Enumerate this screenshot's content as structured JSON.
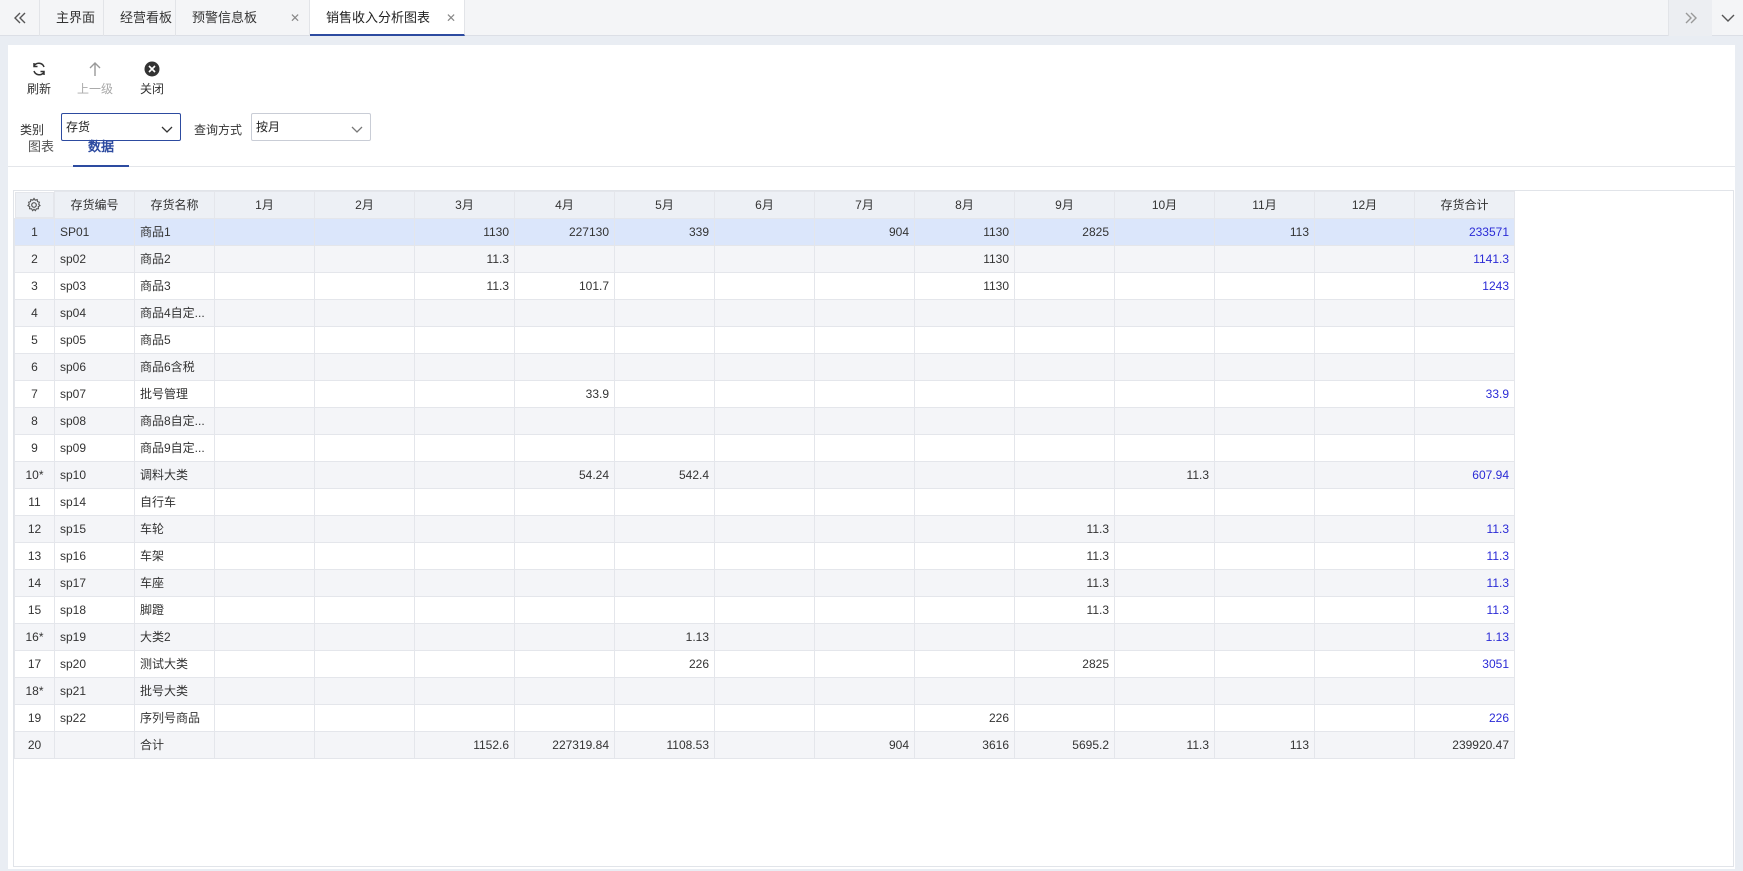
{
  "tabs": [
    {
      "label": "主界面",
      "closable": false,
      "active": false
    },
    {
      "label": "经营看板",
      "closable": false,
      "active": false
    },
    {
      "label": "预警信息板",
      "closable": true,
      "active": false
    },
    {
      "label": "销售收入分析图表",
      "closable": true,
      "active": true
    }
  ],
  "toolbar": {
    "refresh": "刷新",
    "up": "上一级",
    "close": "关闭"
  },
  "filters": {
    "category_label": "类别",
    "category_value": "存货",
    "mode_label": "查询方式",
    "mode_value": "按月"
  },
  "view_tabs": [
    {
      "label": "图表",
      "active": false
    },
    {
      "label": "数据",
      "active": true
    }
  ],
  "grid": {
    "columns": [
      "存货编号",
      "存货名称",
      "1月",
      "2月",
      "3月",
      "4月",
      "5月",
      "6月",
      "7月",
      "8月",
      "9月",
      "10月",
      "11月",
      "12月",
      "存货合计"
    ],
    "rows": [
      {
        "idx": "1",
        "code": "SP01",
        "name": "商品1",
        "m": [
          "",
          "",
          "1130",
          "227130",
          "339",
          "",
          "904",
          "1130",
          "2825",
          "",
          "113",
          ""
        ],
        "total": "233571"
      },
      {
        "idx": "2",
        "code": "sp02",
        "name": "商品2",
        "m": [
          "",
          "",
          "11.3",
          "",
          "",
          "",
          "",
          "1130",
          "",
          "",
          "",
          ""
        ],
        "total": "1141.3"
      },
      {
        "idx": "3",
        "code": "sp03",
        "name": "商品3",
        "m": [
          "",
          "",
          "11.3",
          "101.7",
          "",
          "",
          "",
          "1130",
          "",
          "",
          "",
          ""
        ],
        "total": "1243"
      },
      {
        "idx": "4",
        "code": "sp04",
        "name": "商品4自定...",
        "m": [
          "",
          "",
          "",
          "",
          "",
          "",
          "",
          "",
          "",
          "",
          "",
          ""
        ],
        "total": ""
      },
      {
        "idx": "5",
        "code": "sp05",
        "name": "商品5",
        "m": [
          "",
          "",
          "",
          "",
          "",
          "",
          "",
          "",
          "",
          "",
          "",
          ""
        ],
        "total": ""
      },
      {
        "idx": "6",
        "code": "sp06",
        "name": "商品6含税",
        "m": [
          "",
          "",
          "",
          "",
          "",
          "",
          "",
          "",
          "",
          "",
          "",
          ""
        ],
        "total": ""
      },
      {
        "idx": "7",
        "code": "sp07",
        "name": "批号管理",
        "m": [
          "",
          "",
          "",
          "33.9",
          "",
          "",
          "",
          "",
          "",
          "",
          "",
          ""
        ],
        "total": "33.9"
      },
      {
        "idx": "8",
        "code": "sp08",
        "name": "商品8自定...",
        "m": [
          "",
          "",
          "",
          "",
          "",
          "",
          "",
          "",
          "",
          "",
          "",
          ""
        ],
        "total": ""
      },
      {
        "idx": "9",
        "code": "sp09",
        "name": "商品9自定...",
        "m": [
          "",
          "",
          "",
          "",
          "",
          "",
          "",
          "",
          "",
          "",
          "",
          ""
        ],
        "total": ""
      },
      {
        "idx": "10*",
        "code": "sp10",
        "name": "调料大类",
        "m": [
          "",
          "",
          "",
          "54.24",
          "542.4",
          "",
          "",
          "",
          "",
          "11.3",
          "",
          ""
        ],
        "total": "607.94"
      },
      {
        "idx": "11",
        "code": "sp14",
        "name": "自行车",
        "m": [
          "",
          "",
          "",
          "",
          "",
          "",
          "",
          "",
          "",
          "",
          "",
          ""
        ],
        "total": ""
      },
      {
        "idx": "12",
        "code": "sp15",
        "name": "车轮",
        "m": [
          "",
          "",
          "",
          "",
          "",
          "",
          "",
          "",
          "11.3",
          "",
          "",
          ""
        ],
        "total": "11.3"
      },
      {
        "idx": "13",
        "code": "sp16",
        "name": "车架",
        "m": [
          "",
          "",
          "",
          "",
          "",
          "",
          "",
          "",
          "11.3",
          "",
          "",
          ""
        ],
        "total": "11.3"
      },
      {
        "idx": "14",
        "code": "sp17",
        "name": "车座",
        "m": [
          "",
          "",
          "",
          "",
          "",
          "",
          "",
          "",
          "11.3",
          "",
          "",
          ""
        ],
        "total": "11.3"
      },
      {
        "idx": "15",
        "code": "sp18",
        "name": "脚蹬",
        "m": [
          "",
          "",
          "",
          "",
          "",
          "",
          "",
          "",
          "11.3",
          "",
          "",
          ""
        ],
        "total": "11.3"
      },
      {
        "idx": "16*",
        "code": "sp19",
        "name": "大类2",
        "m": [
          "",
          "",
          "",
          "",
          "1.13",
          "",
          "",
          "",
          "",
          "",
          "",
          ""
        ],
        "total": "1.13"
      },
      {
        "idx": "17",
        "code": "sp20",
        "name": "测试大类",
        "m": [
          "",
          "",
          "",
          "",
          "226",
          "",
          "",
          "",
          "2825",
          "",
          "",
          ""
        ],
        "total": "3051"
      },
      {
        "idx": "18*",
        "code": "sp21",
        "name": "批号大类",
        "m": [
          "",
          "",
          "",
          "",
          "",
          "",
          "",
          "",
          "",
          "",
          "",
          ""
        ],
        "total": ""
      },
      {
        "idx": "19",
        "code": "sp22",
        "name": "序列号商品",
        "m": [
          "",
          "",
          "",
          "",
          "",
          "",
          "",
          "226",
          "",
          "",
          "",
          ""
        ],
        "total": "226"
      },
      {
        "idx": "20",
        "code": "",
        "name": "合计",
        "m": [
          "",
          "",
          "1152.6",
          "227319.84",
          "1108.53",
          "",
          "904",
          "3616",
          "5695.2",
          "11.3",
          "113",
          ""
        ],
        "total": "239920.47"
      }
    ]
  }
}
